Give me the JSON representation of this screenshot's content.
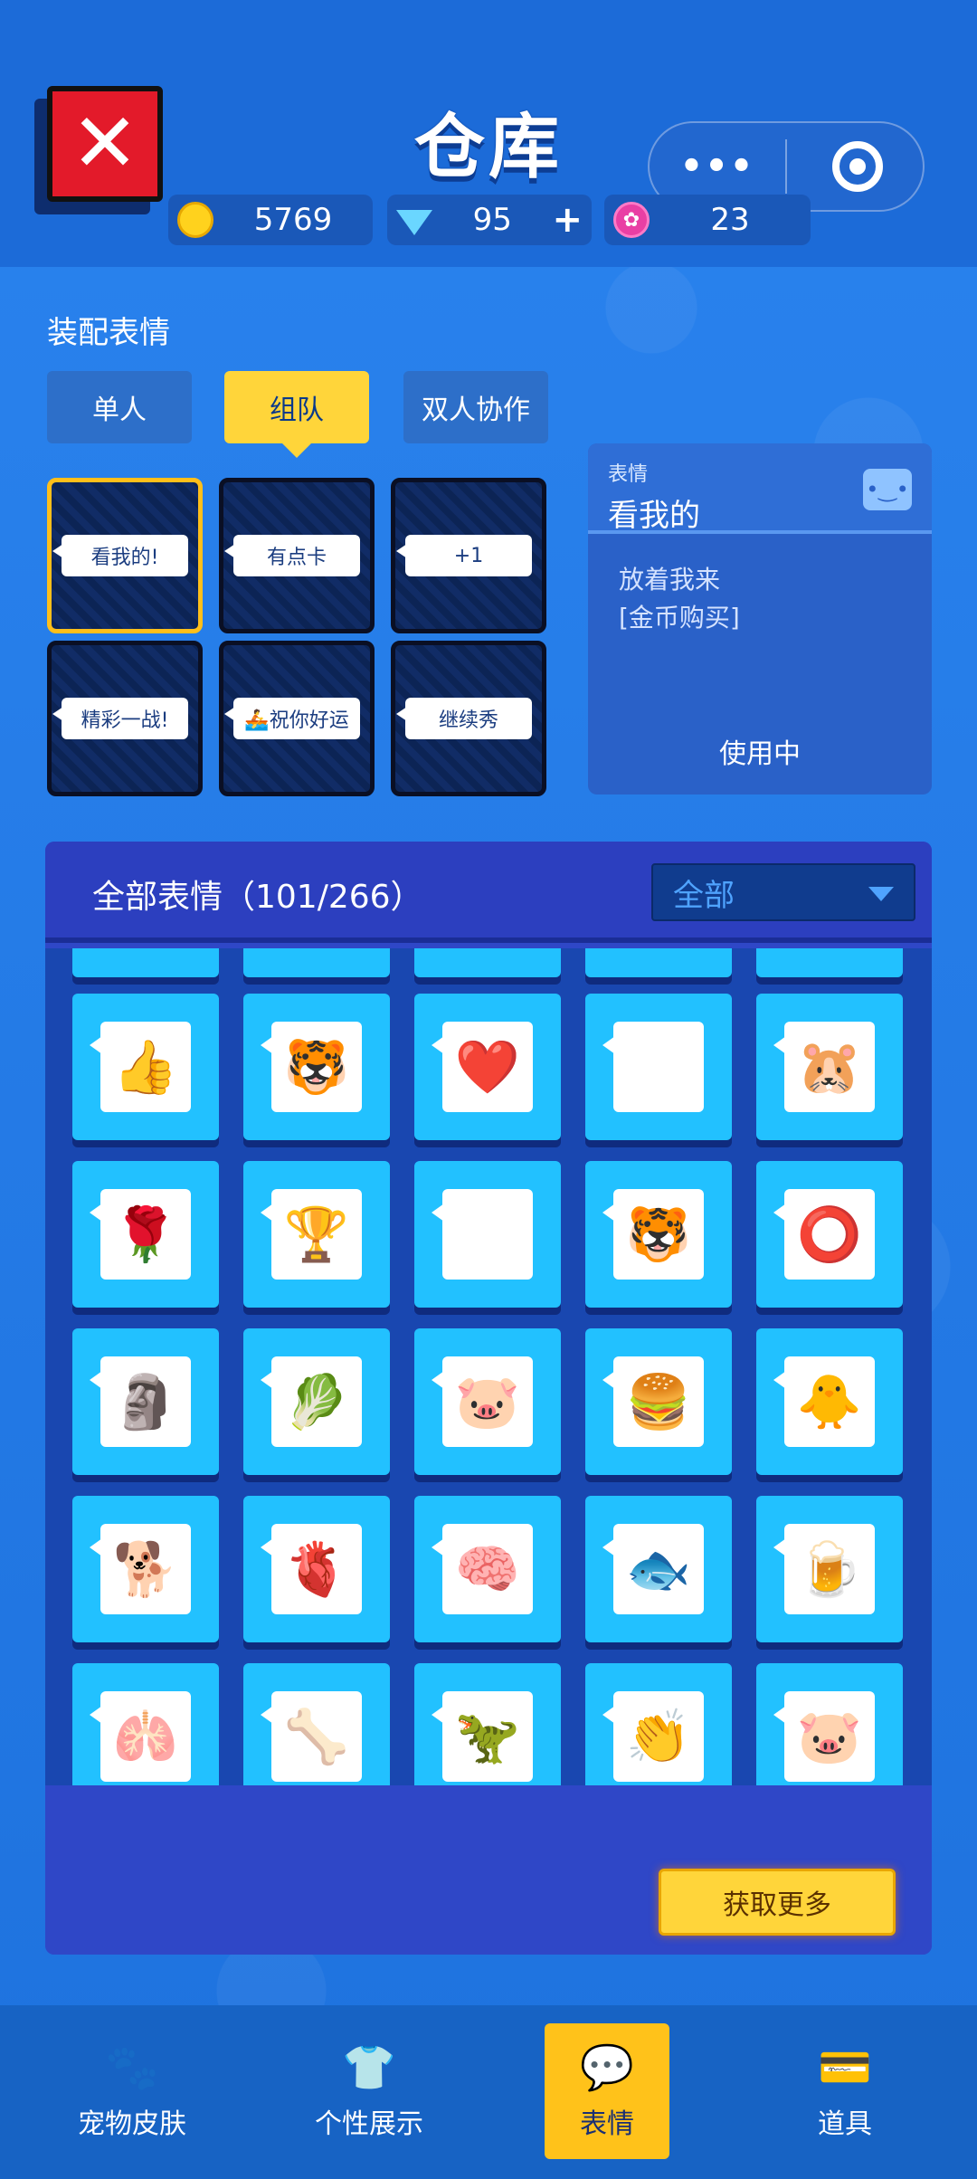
{
  "header": {
    "title": "仓库",
    "close_icon": "close-icon",
    "capsule_dots": "•••",
    "currencies": [
      {
        "name": "coin",
        "value": "5769",
        "color": "#ffd21d"
      },
      {
        "name": "gem",
        "value": "95",
        "plus": "+",
        "color": "#6ad6ff"
      },
      {
        "name": "flower",
        "value": "23",
        "color": "#e93fa4"
      }
    ]
  },
  "equip": {
    "label": "装配表情",
    "tabs": [
      {
        "label": "单人"
      },
      {
        "label": "组队"
      },
      {
        "label": "双人协作"
      }
    ],
    "active_tab": "组队",
    "slots": [
      {
        "text": "看我的!"
      },
      {
        "text": "有点卡"
      },
      {
        "text": "+1"
      },
      {
        "text": "精彩一战!"
      },
      {
        "text": "🚣祝你好运"
      },
      {
        "text": "继续秀"
      }
    ]
  },
  "detail": {
    "small": "表情",
    "name": "看我的",
    "line1": "放着我来",
    "line2": "[金币购买]",
    "status": "使用中"
  },
  "collection": {
    "title": "全部表情（101/266）",
    "filter": "全部",
    "more_button": "获取更多",
    "emojis": [
      [
        "👍",
        "🐯",
        "❤️",
        "🐭",
        "🐹"
      ],
      [
        "🌹",
        "🏆",
        "🐵",
        "🐯",
        "⭕"
      ],
      [
        "🗿",
        "🥬",
        "🐷",
        "🍔",
        "🐥"
      ],
      [
        "🐕",
        "🫀",
        "🧠",
        "🐟",
        "🍺"
      ],
      [
        "🫁",
        "🦴",
        "🦖",
        "👏",
        "🐷"
      ]
    ]
  },
  "nav": {
    "items": [
      {
        "label": "宠物皮肤",
        "icon": "🐾"
      },
      {
        "label": "个性展示",
        "icon": "👕"
      },
      {
        "label": "表情",
        "icon": "💬"
      },
      {
        "label": "道具",
        "icon": "💳"
      }
    ],
    "active": "表情"
  }
}
